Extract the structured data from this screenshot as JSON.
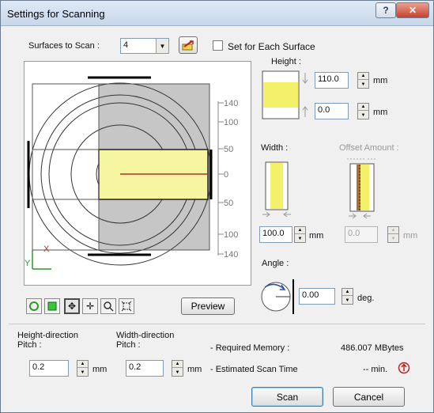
{
  "window": {
    "title": "Settings for Scanning"
  },
  "surfaces": {
    "label": "Surfaces to Scan :",
    "value": "4",
    "set_each_label": "Set for Each Surface"
  },
  "height": {
    "label": "Height :",
    "upper_value": "110.0",
    "lower_value": "0.0",
    "unit": "mm"
  },
  "width": {
    "label": "Width :",
    "value": "100.0",
    "unit": "mm"
  },
  "offset": {
    "label": "Offset Amount :",
    "value": "0.0",
    "unit": "mm"
  },
  "angle": {
    "label": "Angle :",
    "value": "0.00",
    "unit": "deg."
  },
  "ruler": {
    "ticks": [
      "140",
      "100",
      "50",
      "0",
      "50",
      "100",
      "140"
    ]
  },
  "preview": {
    "button_label": "Preview",
    "axis_y": "Y",
    "axis_x": "X"
  },
  "toolbar": {
    "icons": [
      "circle-select-icon",
      "rect-select-icon",
      "move-cursor-icon",
      "pan-icon",
      "zoom-icon",
      "fit-icon"
    ]
  },
  "pitch": {
    "height_label_1": "Height-direction",
    "height_label_2": "Pitch :",
    "height_value": "0.2",
    "width_label_1": "Width-direction",
    "width_label_2": "Pitch :",
    "width_value": "0.2",
    "unit": "mm"
  },
  "memory": {
    "label": "- Required Memory :",
    "value": "486.007 MBytes"
  },
  "scantime": {
    "label": "- Estimated Scan Time",
    "value": "-- min."
  },
  "buttons": {
    "scan": "Scan",
    "cancel": "Cancel"
  },
  "colors": {
    "yellow": "#f6f5a0",
    "grey_region": "#c6c6c6",
    "red_line": "#b03030",
    "accent": "#3c7fb1"
  }
}
